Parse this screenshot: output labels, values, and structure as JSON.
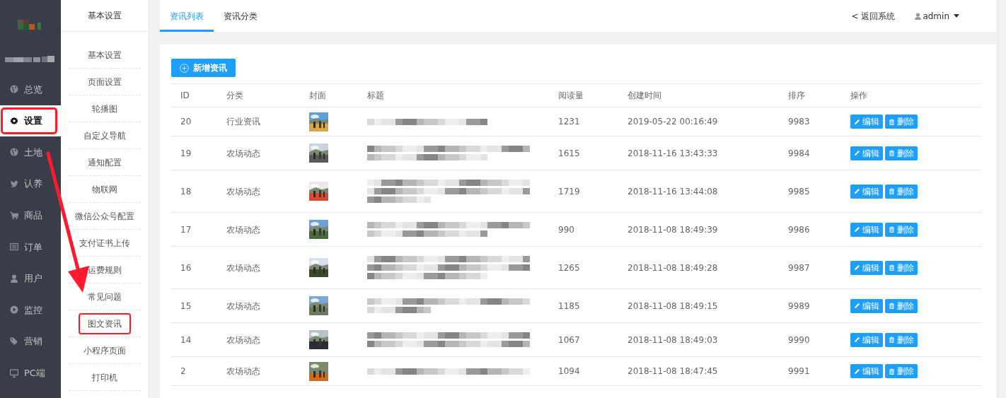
{
  "sidebar": {
    "items": [
      {
        "label": "总览",
        "selected": false,
        "annotated": false
      },
      {
        "label": "设置",
        "selected": true,
        "annotated": true
      },
      {
        "label": "土地",
        "selected": false,
        "annotated": false
      },
      {
        "label": "认养",
        "selected": false,
        "annotated": false
      },
      {
        "label": "商品",
        "selected": false,
        "annotated": false
      },
      {
        "label": "订单",
        "selected": false,
        "annotated": false
      },
      {
        "label": "用户",
        "selected": false,
        "annotated": false
      },
      {
        "label": "监控",
        "selected": false,
        "annotated": false
      },
      {
        "label": "营销",
        "selected": false,
        "annotated": false
      },
      {
        "label": "PC端",
        "selected": false,
        "annotated": false
      }
    ]
  },
  "subnav": {
    "title": "基本设置",
    "items": [
      {
        "label": "基本设置",
        "annotated": false
      },
      {
        "label": "页面设置",
        "annotated": false
      },
      {
        "label": "轮播图",
        "annotated": false
      },
      {
        "label": "自定义导航",
        "annotated": false
      },
      {
        "label": "通知配置",
        "annotated": false
      },
      {
        "label": "物联网",
        "annotated": false
      },
      {
        "label": "微信公众号配置",
        "annotated": false
      },
      {
        "label": "支付证书上传",
        "annotated": false
      },
      {
        "label": "运费规则",
        "annotated": false
      },
      {
        "label": "常见问题",
        "annotated": false
      },
      {
        "label": "图文资讯",
        "annotated": true
      },
      {
        "label": "小程序页面",
        "annotated": false
      },
      {
        "label": "打印机",
        "annotated": false
      }
    ]
  },
  "annotation": {
    "arrow": true
  },
  "tabs": [
    {
      "label": "资讯列表",
      "selected": true
    },
    {
      "label": "资讯分类",
      "selected": false
    }
  ],
  "header": {
    "back_link": "< 返回系统",
    "user": "admin"
  },
  "add_button": "新增资讯",
  "table": {
    "columns": [
      "ID",
      "分类",
      "封面",
      "标题",
      "阅读量",
      "创建时间",
      "排序",
      "操作"
    ],
    "rows": [
      {
        "id": "20",
        "category": "行业资讯",
        "title": {
          "kind": "blurred"
        },
        "reads": "1231",
        "created": "2019-05-22 00:16:49",
        "sort": "9983",
        "actions": [
          "编辑",
          "删除"
        ]
      },
      {
        "id": "19",
        "category": "农场动态",
        "title": {
          "kind": "blurred"
        },
        "reads": "1615",
        "created": "2018-11-16 13:43:33",
        "sort": "9984",
        "actions": [
          "编辑",
          "删除"
        ]
      },
      {
        "id": "18",
        "category": "农场动态",
        "title": {
          "kind": "blurred"
        },
        "reads": "1719",
        "created": "2018-11-16 13:44:08",
        "sort": "9985",
        "actions": [
          "编辑",
          "删除"
        ]
      },
      {
        "id": "17",
        "category": "农场动态",
        "title": {
          "kind": "blurred"
        },
        "reads": "990",
        "created": "2018-11-08 18:49:39",
        "sort": "9986",
        "actions": [
          "编辑",
          "删除"
        ]
      },
      {
        "id": "16",
        "category": "农场动态",
        "title": {
          "kind": "blurred"
        },
        "reads": "1265",
        "created": "2018-11-08 18:49:28",
        "sort": "9987",
        "actions": [
          "编辑",
          "删除"
        ]
      },
      {
        "id": "15",
        "category": "农场动态",
        "title": {
          "kind": "blurred"
        },
        "reads": "1185",
        "created": "2018-11-08 18:49:15",
        "sort": "9989",
        "actions": [
          "编辑",
          "删除"
        ]
      },
      {
        "id": "14",
        "category": "农场动态",
        "title": {
          "kind": "blurred"
        },
        "reads": "1067",
        "created": "2018-11-08 18:49:03",
        "sort": "9990",
        "actions": [
          "编辑",
          "删除"
        ]
      },
      {
        "id": "2",
        "category": "农场动态",
        "title": {
          "kind": "blurred"
        },
        "reads": "1094",
        "created": "2018-11-08 18:47:45",
        "sort": "9991",
        "actions": [
          "编辑",
          "删除"
        ]
      }
    ]
  }
}
